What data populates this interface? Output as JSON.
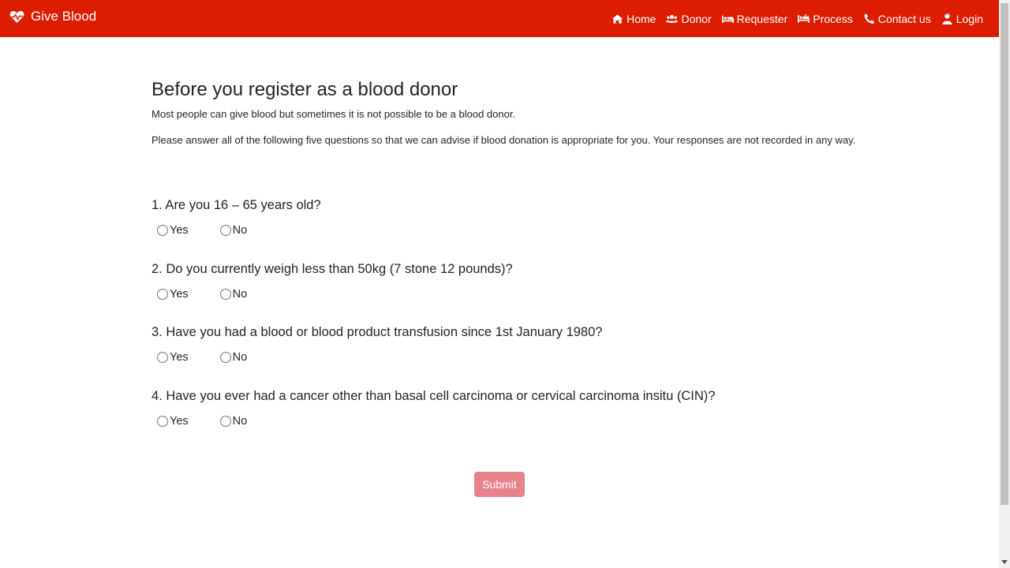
{
  "brand": {
    "name": "Give Blood",
    "icon": "heart-pulse-icon"
  },
  "nav": [
    {
      "label": "Home",
      "icon": "home-icon"
    },
    {
      "label": "Donor",
      "icon": "users-icon"
    },
    {
      "label": "Requester",
      "icon": "bed-icon"
    },
    {
      "label": "Process",
      "icon": "hospital-bed-icon"
    },
    {
      "label": "Contact us",
      "icon": "phone-icon"
    },
    {
      "label": "Login",
      "icon": "user-icon"
    }
  ],
  "page": {
    "title": "Before you register as a blood donor",
    "intro1": "Most people can give blood but sometimes it is not possible to be a blood donor.",
    "intro2": "Please answer all of the following five questions so that we can advise if blood donation is appropriate for you. Your responses are not recorded in any way."
  },
  "questions": [
    {
      "text": "1. Are you 16 – 65 years old?",
      "yes": "Yes",
      "no": "No"
    },
    {
      "text": "2. Do you currently weigh less than 50kg (7 stone 12 pounds)?",
      "yes": "Yes",
      "no": "No"
    },
    {
      "text": "3. Have you had a blood or blood product transfusion since 1st January 1980?",
      "yes": "Yes",
      "no": "No"
    },
    {
      "text": "4. Have you ever had a cancer other than basal cell carcinoma or cervical carcinoma insitu (CIN)?",
      "yes": "Yes",
      "no": "No"
    }
  ],
  "submit_label": "Submit",
  "colors": {
    "navbar": "#dc1d02",
    "submit": "#e7818c"
  }
}
